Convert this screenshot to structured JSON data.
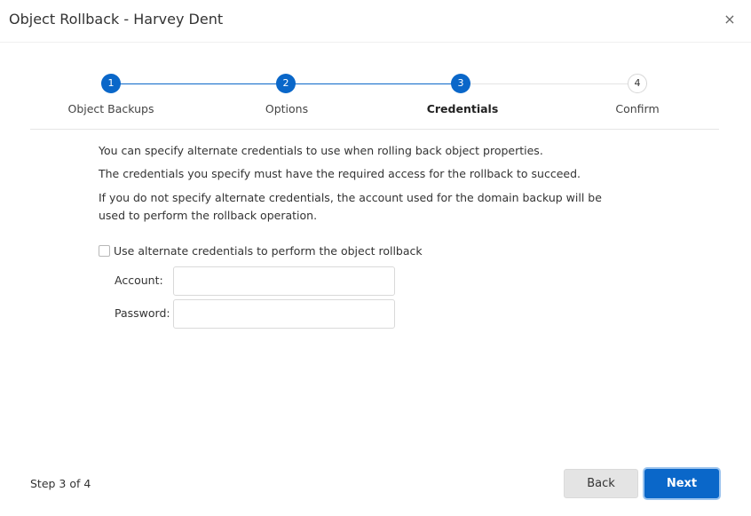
{
  "dialog": {
    "title": "Object Rollback - Harvey Dent",
    "close_glyph": "×"
  },
  "stepper": {
    "steps": [
      {
        "number": "1",
        "label": "Object Backups",
        "state": "completed"
      },
      {
        "number": "2",
        "label": "Options",
        "state": "completed"
      },
      {
        "number": "3",
        "label": "Credentials",
        "state": "current"
      },
      {
        "number": "4",
        "label": "Confirm",
        "state": "pending"
      }
    ]
  },
  "content": {
    "paragraphs": [
      "You can specify alternate credentials to use when rolling back object properties.",
      "The credentials you specify must have the required access for the rollback to succeed.",
      "If you do not specify alternate credentials, the account used for the domain backup will be used to perform the rollback operation."
    ],
    "checkbox": {
      "label": "Use alternate credentials to perform the object rollback",
      "checked": false
    },
    "account": {
      "label": "Account:",
      "value": ""
    },
    "password": {
      "label": "Password:",
      "value": ""
    }
  },
  "footer": {
    "status": "Step 3 of 4",
    "back_label": "Back",
    "next_label": "Next"
  },
  "colors": {
    "accent": "#0a67c9",
    "inactive_line": "#e3e3e3",
    "back_button": "#e4e4e4"
  }
}
